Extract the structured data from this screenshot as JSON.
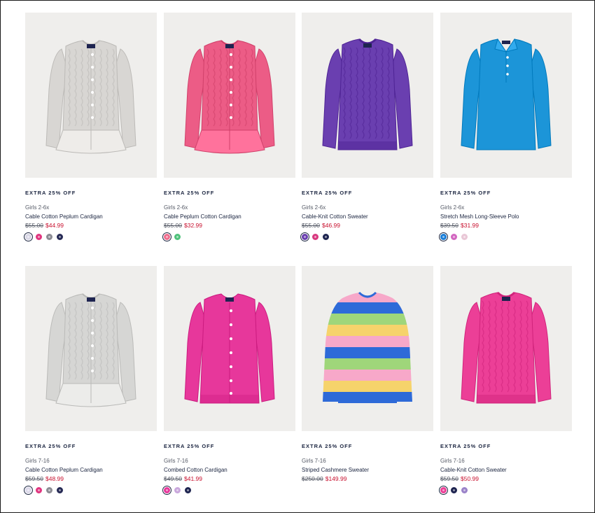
{
  "products": [
    {
      "promo": "EXTRA 25% OFF",
      "category": "Girls 2-6x",
      "name": "Cable Cotton Peplum Cardigan",
      "original_price": "$55.00",
      "sale_price": "$44.99",
      "image_icon": "cardigan-peplum",
      "main_color": "#d8d6d3",
      "swatches": [
        "#d9d7e6",
        "#e0357f",
        "#8c8c94",
        "#262a55"
      ]
    },
    {
      "promo": "EXTRA 25% OFF",
      "category": "Girls 2-6x",
      "name": "Cable Peplum Cotton Cardigan",
      "original_price": "$55.00",
      "sale_price": "$32.99",
      "image_icon": "cardigan-peplum",
      "main_color": "#ec5c86",
      "swatches": [
        "#ef6d8e",
        "#4fc27b"
      ]
    },
    {
      "promo": "EXTRA 25% OFF",
      "category": "Girls 2-6x",
      "name": "Cable-Knit Cotton Sweater",
      "original_price": "$55.00",
      "sale_price": "$46.99",
      "image_icon": "sweater-crew",
      "main_color": "#6a3fb0",
      "swatches": [
        "#6a3fb0",
        "#d8397f",
        "#1e2450"
      ]
    },
    {
      "promo": "EXTRA 25% OFF",
      "category": "Girls 2-6x",
      "name": "Stretch Mesh Long-Sleeve Polo",
      "original_price": "$39.50",
      "sale_price": "$31.99",
      "image_icon": "polo-longsleeve",
      "main_color": "#1c95d8",
      "swatches": [
        "#1c7fd8",
        "#d267c0",
        "#e9c7d6"
      ]
    },
    {
      "promo": "EXTRA 25% OFF",
      "category": "Girls 7-16",
      "name": "Cable Cotton Peplum Cardigan",
      "original_price": "$59.50",
      "sale_price": "$48.99",
      "image_icon": "cardigan-peplum",
      "main_color": "#d6d6d4",
      "swatches": [
        "#dcd9ea",
        "#e0357f",
        "#8c8c94",
        "#262a55"
      ]
    },
    {
      "promo": "EXTRA 25% OFF",
      "category": "Girls 7-16",
      "name": "Combed Cotton Cardigan",
      "original_price": "$49.50",
      "sale_price": "$41.99",
      "image_icon": "cardigan-crew",
      "main_color": "#e7379b",
      "swatches": [
        "#e7379b",
        "#c9a7dc",
        "#1e2450"
      ]
    },
    {
      "promo": "EXTRA 25% OFF",
      "category": "Girls 7-16",
      "name": "Striped Cashmere Sweater",
      "original_price": "$250.00",
      "sale_price": "$149.99",
      "image_icon": "sweater-striped",
      "main_color": "#2e6ad8",
      "swatches": []
    },
    {
      "promo": "EXTRA 25% OFF",
      "category": "Girls 7-16",
      "name": "Cable-Knit Cotton Sweater",
      "original_price": "$59.50",
      "sale_price": "$50.99",
      "image_icon": "sweater-crew",
      "main_color": "#ec3f97",
      "swatches": [
        "#ec3f97",
        "#1e2450",
        "#9a82c9"
      ]
    }
  ]
}
